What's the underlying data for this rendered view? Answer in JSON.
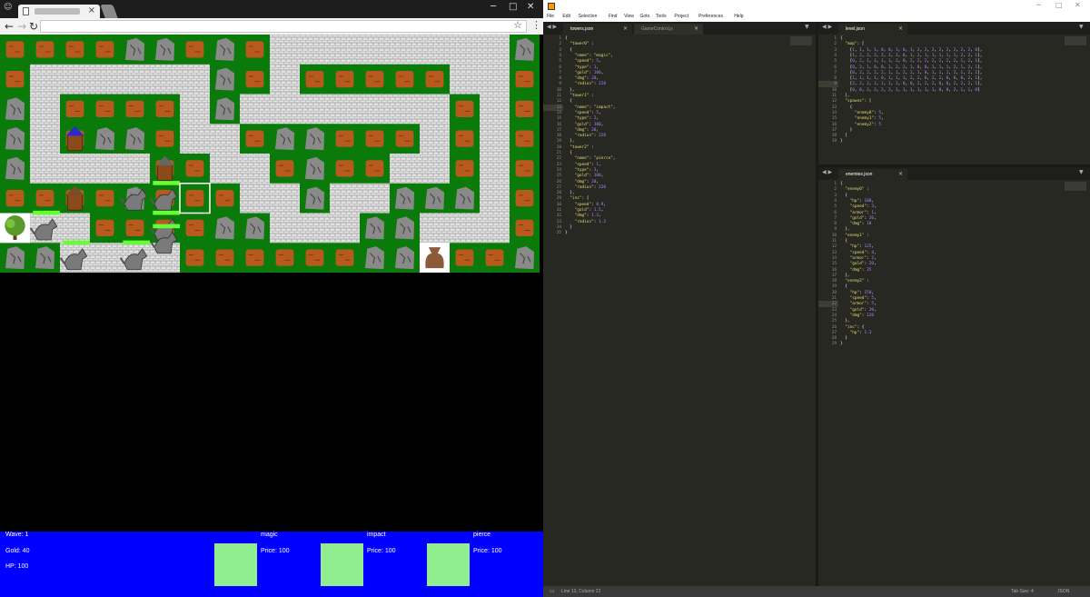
{
  "browser": {
    "tab_title": "",
    "address": "",
    "window_controls": [
      "─",
      "□",
      "✕"
    ]
  },
  "game": {
    "tiles": {
      "cols": 18,
      "rows": 8,
      "legend": {
        "0": "grass-dirt",
        "1": "path",
        "2": "grass-rock"
      },
      "map": [
        [
          0,
          0,
          0,
          0,
          2,
          2,
          0,
          2,
          0,
          1,
          1,
          1,
          1,
          1,
          1,
          1,
          1,
          2
        ],
        [
          0,
          1,
          1,
          1,
          1,
          1,
          1,
          2,
          0,
          1,
          0,
          0,
          0,
          0,
          0,
          1,
          1,
          0
        ],
        [
          2,
          1,
          0,
          0,
          0,
          0,
          1,
          2,
          1,
          1,
          1,
          1,
          1,
          1,
          1,
          0,
          1,
          0
        ],
        [
          2,
          1,
          0,
          2,
          2,
          0,
          1,
          1,
          0,
          2,
          2,
          0,
          0,
          0,
          1,
          0,
          1,
          0
        ],
        [
          2,
          1,
          1,
          1,
          1,
          0,
          0,
          1,
          1,
          0,
          2,
          0,
          0,
          1,
          1,
          0,
          1,
          0
        ],
        [
          0,
          0,
          0,
          0,
          2,
          0,
          0,
          0,
          1,
          1,
          2,
          1,
          1,
          2,
          2,
          2,
          1,
          0
        ],
        [
          1,
          1,
          1,
          0,
          0,
          0,
          0,
          2,
          2,
          1,
          1,
          1,
          2,
          2,
          1,
          1,
          1,
          0
        ],
        [
          2,
          2,
          1,
          1,
          1,
          1,
          0,
          0,
          0,
          0,
          0,
          0,
          2,
          2,
          1,
          0,
          0,
          2
        ]
      ]
    },
    "entities": [
      {
        "kind": "tree-icon",
        "col": 0,
        "row": 6
      },
      {
        "kind": "gold-bag-icon",
        "col": 14,
        "row": 7
      },
      {
        "kind": "magic-tower-icon",
        "col": 2,
        "row": 3
      },
      {
        "kind": "impact-tower-icon",
        "col": 5,
        "row": 4
      },
      {
        "kind": "pierce-tower-icon",
        "col": 2,
        "row": 5
      },
      {
        "kind": "wolf-enemy-icon",
        "col": 4,
        "row": 5,
        "health": 0
      },
      {
        "kind": "wolf-enemy-icon",
        "col": 5,
        "row": 5,
        "health": 1
      },
      {
        "kind": "wolf-enemy-icon",
        "col": 1,
        "row": 6,
        "health": 1
      },
      {
        "kind": "wolf-enemy-icon",
        "col": 5,
        "row": 6,
        "health": 1
      },
      {
        "kind": "wolf-enemy-icon",
        "col": 5,
        "row": 6.45,
        "health": 1
      },
      {
        "kind": "wolf-enemy-icon",
        "col": 2,
        "row": 7,
        "health": 1
      },
      {
        "kind": "wolf-enemy-icon",
        "col": 4,
        "row": 7,
        "health": 1
      }
    ],
    "selected": {
      "col": 6,
      "row": 5
    },
    "colors": {
      "grass": "#0a7a0a",
      "dirt": "#b85a1e",
      "rock": "#8a8a8a",
      "path": "#d8d8d8",
      "health": "#66ff33"
    }
  },
  "hud": {
    "wave_label": "Wave: 1",
    "gold_label": "Gold: 40",
    "hp_label": "HP: 100",
    "towers": [
      {
        "name": "magic",
        "price": "Price: 100"
      },
      {
        "name": "impact",
        "price": "Price: 100"
      },
      {
        "name": "pierce",
        "price": "Price: 100"
      }
    ]
  },
  "editor": {
    "menu": [
      "File",
      "Edit",
      "Selection",
      "Find",
      "View",
      "Goto",
      "Tools",
      "Project",
      "Preferences",
      "Help"
    ],
    "panes": [
      {
        "tabs": [
          "towers.json",
          "GameControl.js"
        ],
        "active_line": 13,
        "lines": [
          "{",
          "  \"tower0\" :",
          "  {",
          "    \"name\": \"magic\",",
          "    \"speed\": 5,",
          "    \"type\": 1,",
          "    \"gold\": 100,",
          "    \"dmg\": 20,",
          "    \"radius\": 220",
          "  },",
          "  \"tower1\" :",
          "  {",
          "    \"name\": \"impact\",",
          "    \"speed\": 5,",
          "    \"type\": 2,",
          "    \"gold\": 100,",
          "    \"dmg\": 20,",
          "    \"radius\": 220",
          "  },",
          "  \"tower2\" :",
          "  {",
          "    \"name\": \"pierce\",",
          "    \"speed\": 1,",
          "    \"type\": 3,",
          "    \"gold\": 100,",
          "    \"dmg\": 20,",
          "    \"radius\": 220",
          "  },",
          "  \"inc\": {",
          "    \"speed\": 0.9,",
          "    \"gold\": 1.5,",
          "    \"dmg\": 1.3,",
          "    \"radius\": 1.2",
          "  }",
          "}"
        ]
      },
      {
        "tabs": [
          "level.json"
        ],
        "active_line": 9,
        "lines": [
          "{",
          "  \"map\": [",
          "    [1, 1, 1, 1, 0, 0, 1, 0, 1, 2, 2, 2, 2, 2, 2, 2, 2, 0],",
          "    [1, 2, 2, 2, 2, 2, 2, 0, 1, 2, 1, 1, 1, 1, 1, 2, 2, 1],",
          "    [0, 2, 1, 1, 1, 1, 2, 0, 2, 2, 2, 2, 2, 2, 2, 1, 2, 1],",
          "    [0, 2, 1, 0, 0, 1, 2, 2, 1, 0, 0, 1, 1, 1, 2, 1, 2, 1],",
          "    [0, 2, 2, 2, 2, 1, 1, 2, 2, 1, 0, 1, 1, 2, 2, 1, 2, 1],",
          "    [1, 1, 1, 1, 0, 1, 1, 1, 2, 2, 0, 2, 2, 0, 0, 0, 2, 1],",
          "    [2, 2, 2, 1, 1, 1, 1, 0, 0, 2, 2, 2, 0, 0, 2, 2, 2, 1],",
          "    [0, 0, 2, 2, 2, 2, 1, 1, 1, 1, 1, 1, 0, 0, 2, 1, 1, 0]",
          "  ],",
          "  \"spawns\": [",
          "    {",
          "      \"enemy0\": 5,",
          "      \"enemy1\": 5,",
          "      \"enemy2\": 5",
          "    }",
          "  ]",
          "}"
        ]
      },
      {
        "tabs": [
          "enemies.json"
        ],
        "active_line": 22,
        "lines": [
          "{",
          "  \"enemy0\" :",
          "  {",
          "    \"hp\": 100,",
          "    \"speed\": 3,",
          "    \"armor\": 1,",
          "    \"gold\": 20,",
          "    \"dmg\": 10",
          "  },",
          "  \"enemy1\" :",
          "  {",
          "    \"hp\": 125,",
          "    \"speed\": 4,",
          "    \"armor\": 2,",
          "    \"gold\": 20,",
          "    \"dmg\": 35",
          "  },",
          "  \"enemy2\" :",
          "  {",
          "    \"hp\": 150,",
          "    \"speed\": 5,",
          "    \"armor\": 5,",
          "    \"gold\": 20,",
          "    \"dmg\": 120",
          "  },",
          "  \"inc\": {",
          "    \"hp\": 1.3",
          "  }",
          "}"
        ]
      }
    ],
    "status_left": "Line 13, Column 22",
    "status_tab": "Tab Size: 4",
    "status_syntax": "JSON",
    "colors": {
      "bg": "#272822",
      "string": "#e6db74",
      "number": "#ae81ff",
      "text": "#f8f8f2",
      "gutter": "#8f908a"
    }
  }
}
